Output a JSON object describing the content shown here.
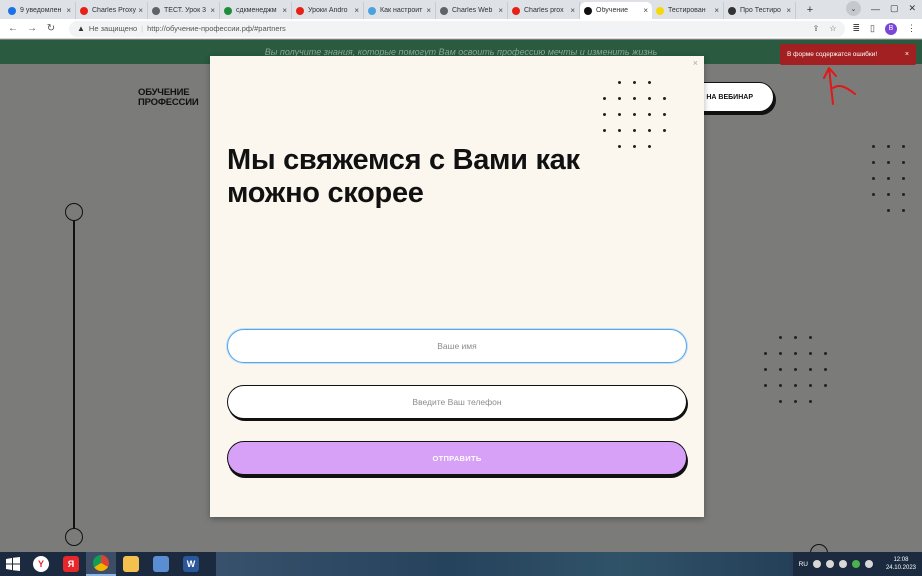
{
  "browser": {
    "tabs": [
      {
        "label": "9 уведомлен",
        "favicon_color": "#1a73e8",
        "active": false
      },
      {
        "label": "Charles Proxy",
        "favicon_color": "#e62117",
        "active": false
      },
      {
        "label": "ТЕСТ. Урок 3",
        "favicon_color": "#5f6368",
        "active": false
      },
      {
        "label": "сдкменеджм",
        "favicon_color": "#1e8e3e",
        "active": false
      },
      {
        "label": "Уроки Andro",
        "favicon_color": "#e62117",
        "active": false
      },
      {
        "label": "Как настроит",
        "favicon_color": "#4aa3df",
        "active": false
      },
      {
        "label": "Charles Web",
        "favicon_color": "#5f6368",
        "active": false
      },
      {
        "label": "Charles prox",
        "favicon_color": "#e62117",
        "active": false
      },
      {
        "label": "Обучение",
        "favicon_color": "#111111",
        "active": true
      },
      {
        "label": "Тестирован",
        "favicon_color": "#f5d90a",
        "active": false
      },
      {
        "label": "Про Тестиро",
        "favicon_color": "#333333",
        "active": false
      }
    ],
    "new_tab": "+",
    "security_label": "Не защищено",
    "url": "http://обучение-профессии.рф/#partners",
    "avatar_letter": "В"
  },
  "page": {
    "banner_text": "Вы получите знания, которые помогут Вам освоить профессию мечты и изменить жизнь",
    "logo_line1": "ОБУЧЕНИЕ",
    "logo_line2": "ПРОФЕССИИ",
    "webinar_button": "НА ВЕБИНАР"
  },
  "toast": {
    "message": "В форме содержатся ошибки!",
    "close": "×",
    "color": "#a21f22"
  },
  "modal": {
    "title": "Мы свяжемся с Вами как можно скорее",
    "close": "×",
    "name_placeholder": "Ваше имя",
    "phone_placeholder": "Введите Ваш телефон",
    "submit_label": "ОТПРАВИТЬ",
    "submit_color": "#d6a1f6",
    "focus_color": "#58a6e8"
  },
  "taskbar": {
    "lang": "RU",
    "time": "12:08",
    "date": "24.10.2023"
  }
}
